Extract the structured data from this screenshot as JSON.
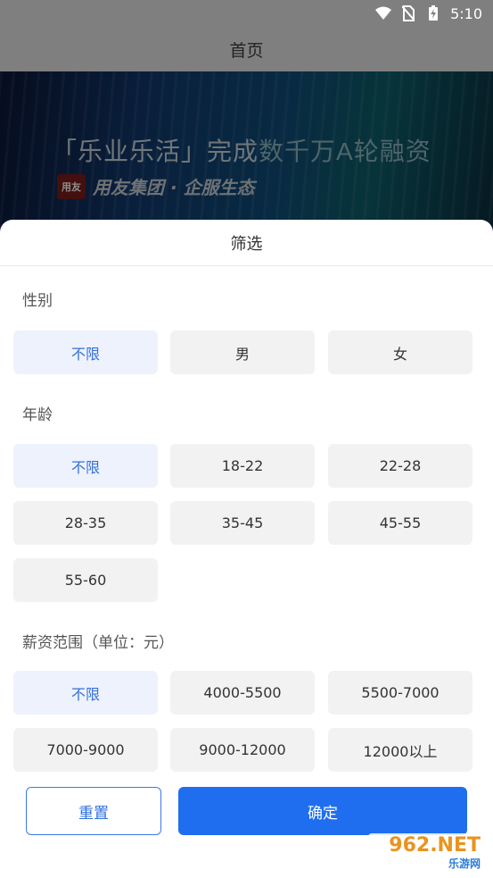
{
  "status_bar": {
    "time": "5:10",
    "icons": [
      "wifi-icon",
      "no-sim-icon",
      "battery-charging-icon"
    ]
  },
  "header": {
    "title": "首页"
  },
  "banner": {
    "headline_prefix": "「乐业乐活」完成",
    "headline_highlight": "数千万A轮融资",
    "logo_text": "用友",
    "subtitle": "用友集团 · 企服生态"
  },
  "filter": {
    "title": "筛选",
    "gender": {
      "label": "性别",
      "options": [
        "不限",
        "男",
        "女"
      ],
      "selected": "不限"
    },
    "age": {
      "label": "年龄",
      "options": [
        "不限",
        "18-22",
        "22-28",
        "28-35",
        "35-45",
        "45-55",
        "55-60"
      ],
      "selected": "不限"
    },
    "salary": {
      "label": "薪资范围（单位：元）",
      "options": [
        "不限",
        "4000-5500",
        "5500-7000",
        "7000-9000",
        "9000-12000",
        "12000以上"
      ],
      "selected": "不限"
    },
    "reset_label": "重置",
    "confirm_label": "确定"
  },
  "watermark": {
    "big": "962.NET",
    "small": "乐游网"
  },
  "colors": {
    "accent": "#1f6ef0",
    "selected_bg": "#edf2fc",
    "selected_text": "#3570d8",
    "option_bg": "#f2f2f2"
  }
}
